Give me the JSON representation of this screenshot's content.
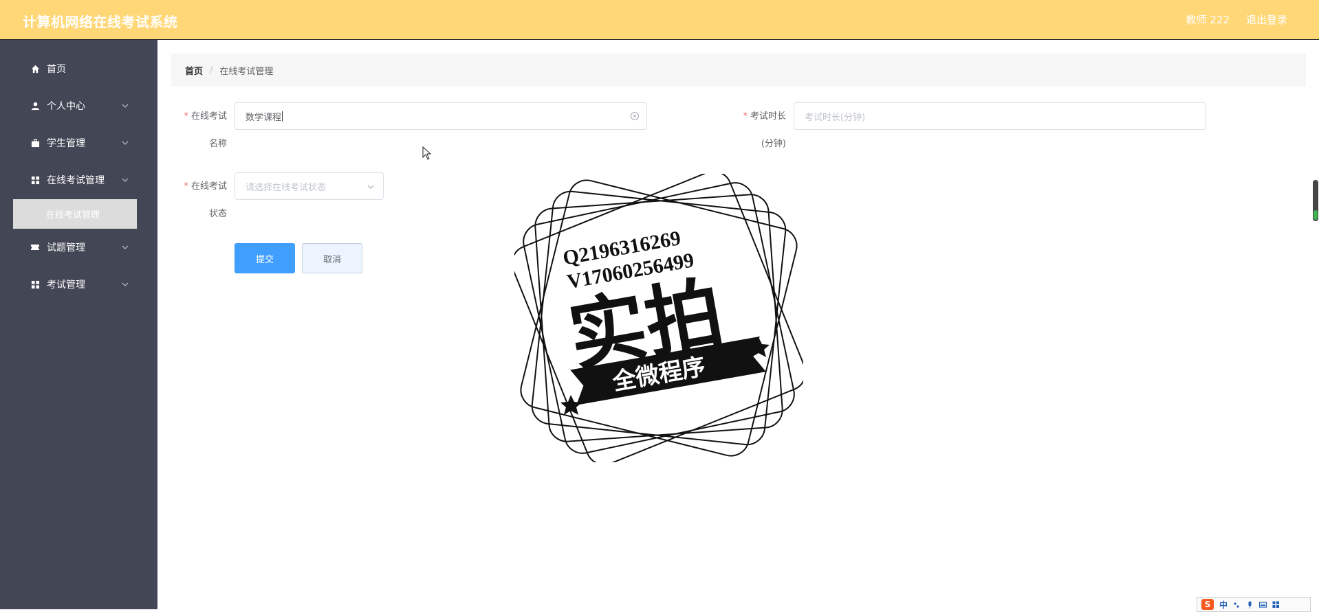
{
  "header": {
    "title": "计算机网络在线考试系统",
    "user": "教师 222",
    "logout": "退出登录"
  },
  "sidebar": {
    "items": [
      {
        "label": "首页",
        "icon": "home-icon"
      },
      {
        "label": "个人中心",
        "icon": "user-icon"
      },
      {
        "label": "学生管理",
        "icon": "briefcase-icon"
      },
      {
        "label": "在线考试管理",
        "icon": "grid-icon"
      },
      {
        "label": "试题管理",
        "icon": "ticket-icon"
      },
      {
        "label": "考试管理",
        "icon": "grid-icon"
      }
    ],
    "submenu_active": "在线考试管理"
  },
  "breadcrumb": {
    "home": "首页",
    "separator": "/",
    "current": "在线考试管理"
  },
  "form": {
    "required_mark": "*",
    "name_label_1": "在线考试",
    "name_label_2": "名称",
    "name_value": "数学课程",
    "duration_label_1": "考试时长",
    "duration_label_2": "(分钟)",
    "duration_placeholder": "考试时长(分钟)",
    "status_label_1": "在线考试",
    "status_label_2": "状态",
    "status_placeholder": "请选择在线考试状态",
    "submit": "提交",
    "cancel": "取消"
  },
  "watermark": {
    "line1": "Q2196316269",
    "line2": "V17060256499",
    "big": "实拍",
    "banner": "全微程序"
  },
  "ime": {
    "logo": "S",
    "lang": "中"
  },
  "colors": {
    "header_bg": "#ffd777",
    "sidebar_bg": "#424655",
    "primary": "#409eff",
    "required": "#f56c6c"
  }
}
